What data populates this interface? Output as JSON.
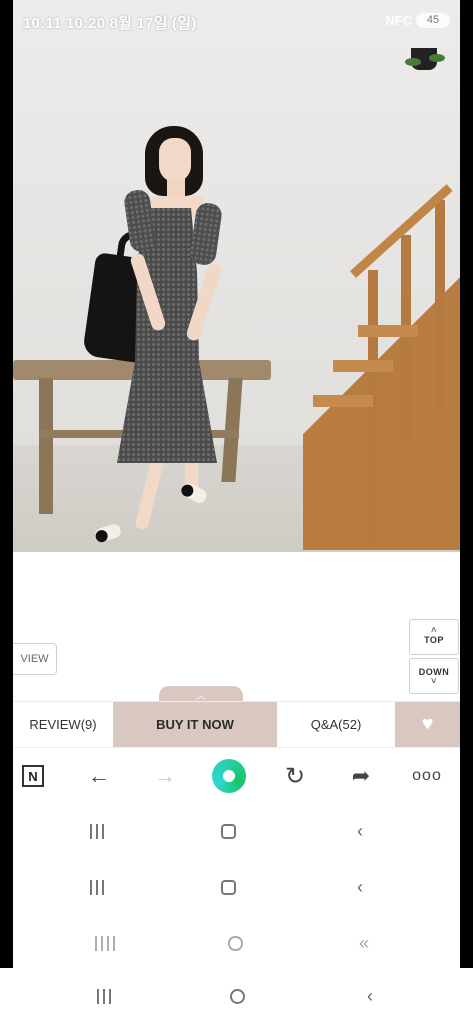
{
  "status_bar": {
    "text": "10:11 10:20 8월 17일 (일)",
    "right_text": "NFC",
    "battery": "45"
  },
  "page": {
    "view_label": "VIEW",
    "top_label": "TOP",
    "down_label": "DOWN"
  },
  "tabs": {
    "review": "REVIEW(9)",
    "buy": "BUY IT NOW",
    "qa": "Q&A(52)"
  },
  "icons": {
    "n": "N",
    "back": "←",
    "forward": "→",
    "refresh": "↻",
    "share": "➦",
    "more": "ooo",
    "heart": "♥",
    "collapse": "︿"
  },
  "colors": {
    "accent": "#d9c7c1",
    "green": "#18c46a"
  }
}
